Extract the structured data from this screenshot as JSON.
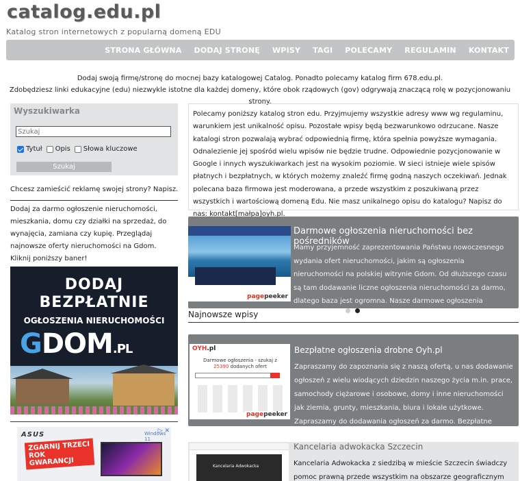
{
  "site": {
    "logo": "catalog.edu.pl",
    "tagline": "Katalog stron internetowych z popularną domeną EDU"
  },
  "nav": {
    "items": [
      "STRONA GŁÓWNA",
      "DODAJ STRONĘ",
      "WPISY",
      "TAGI",
      "POLECAMY",
      "REGULAMIN",
      "KONTAKT"
    ]
  },
  "intro": {
    "line1": "Dodaj swoją firmę/stronę do mocnej bazy katalogowej Catalog. Ponadto polecamy katalog firm 678.edu.pl.",
    "line2": "Zdobędziesz linki edukacyjne (edu) niezwykle istotne dla każdej domeny, które obok rządowych (gov) odgrywają znaczącą rolę w pozycjonowaniu strony."
  },
  "search": {
    "title": "Wyszukiwarka",
    "placeholder": "Szukaj",
    "options": [
      {
        "label": "Tytuł",
        "checked": true
      },
      {
        "label": "Opis",
        "checked": false
      },
      {
        "label": "Słowa kluczowe",
        "checked": false
      }
    ],
    "button": "Szukaj"
  },
  "sidebar": {
    "ad_question": "Chcesz zamieścić reklamę swojej strony? Napisz.",
    "gdom_text": "Dodaj za darmo ogłoszenie nieruchomości, mieszkania, domu czy działki na sprzedaż, do wynajęcia, zamiana czy kupię. Przeglądaj najnowsze oferty nieruchomości na Gdom. Kliknij poniższy baner!",
    "gdom_banner": {
      "line1": "DODAJ",
      "line2": "BEZPŁATNIE",
      "line3": "OGŁOSZENIA NIERUCHOMOŚCI",
      "logo_g": "G",
      "logo_rest": "DOM",
      "logo_pl": ".PL"
    },
    "asus_ad": {
      "brand": "ASUS",
      "badge": "Windows 11",
      "slogan": "ZGARNIJ TRZECI ROK GWARANCJI",
      "close": "▷ ✕"
    }
  },
  "description": "Polecamy poniższy katalog stron edu. Przyjmujemy wszystkie adresy www wg regulaminu, warunkiem jest unikalność opisu. Pozostałe wpisy będą bezwarunkowo odrzucane. Nasze katalogi stron pozwalają wybrać odpowiednią firmę, która spełnia powyższe wymagania. Odnalezienie jej spośród wielu wpisów nie będzie trudne. Odpowiednie pozycjonowanie w Google i innych wyszukiwarkach jest na wysokim poziomie. W sieci istnieje wiele spisów płatnych i bezpłatnych, w których możemy znaleźć firmę godną naszych oczekiwań. Jednak polecana baza firmowa jest moderowana, a przede wszystkim z poszukiwaną przez wszystkich i wartościową domeną Edu. Nie masz unikalnego opisu do katalogu? Napisz do nas: kontakt[małpa]oyh.pl.",
  "slider": {
    "title": "Darmowe ogłoszenia nieruchomości bez pośredników",
    "body": "Mamy przyjemność zaprezentowania Państwu nowoczesnego wydania ofert nieruchomości, jakim są ogłoszenia nieruchomości na polskiej witrynie Gdom. Od dłuższego czasu są tam dodawanie liczne ogłoszenia nieruchomości za darmo, dlatego baza jest ogromna. Nasze darmowe ogłoszenia nieruchomości cechuje brak opłat za",
    "thumb_label_a": "page",
    "thumb_label_b": "peeker",
    "active_dot": 2
  },
  "newest": {
    "heading": "Najnowsze wpisy",
    "entries": [
      {
        "title": "Bezpłatne ogłoszenia drobne Oyh.pl",
        "body": "Zapraszamy do zapoznania się z naszą ofertą, u nas dodawanie ogłoszeń z wielu wiodących dziedzin naszego życia m.in. prace, samochody ciężarowe i osobowe, domy i inne nieruchomości jak ziemia, grunty, mieszkania, biura i lokale użytkowe. Zapraszamy do dodawania ogłoszeń za darmo. Bezpłatne dodawanie ogłoszeń mają",
        "thumb_logo_a": "OYH",
        "thumb_logo_b": ".pl",
        "thumb_head_a": "Darmowe ogłoszenia - szukaj z ",
        "thumb_head_num": "25390",
        "thumb_head_b": " dodanych ofert"
      },
      {
        "title": "Kancelaria adwokacka Szczecin",
        "body": "Kancelaria Adwokacka z siedzibą w mieście Szczecin świadczy pomoc prawną przede wszystkim na obszarze geograficznym",
        "thumb_text": "Kancelaria Adwokacka"
      }
    ]
  }
}
